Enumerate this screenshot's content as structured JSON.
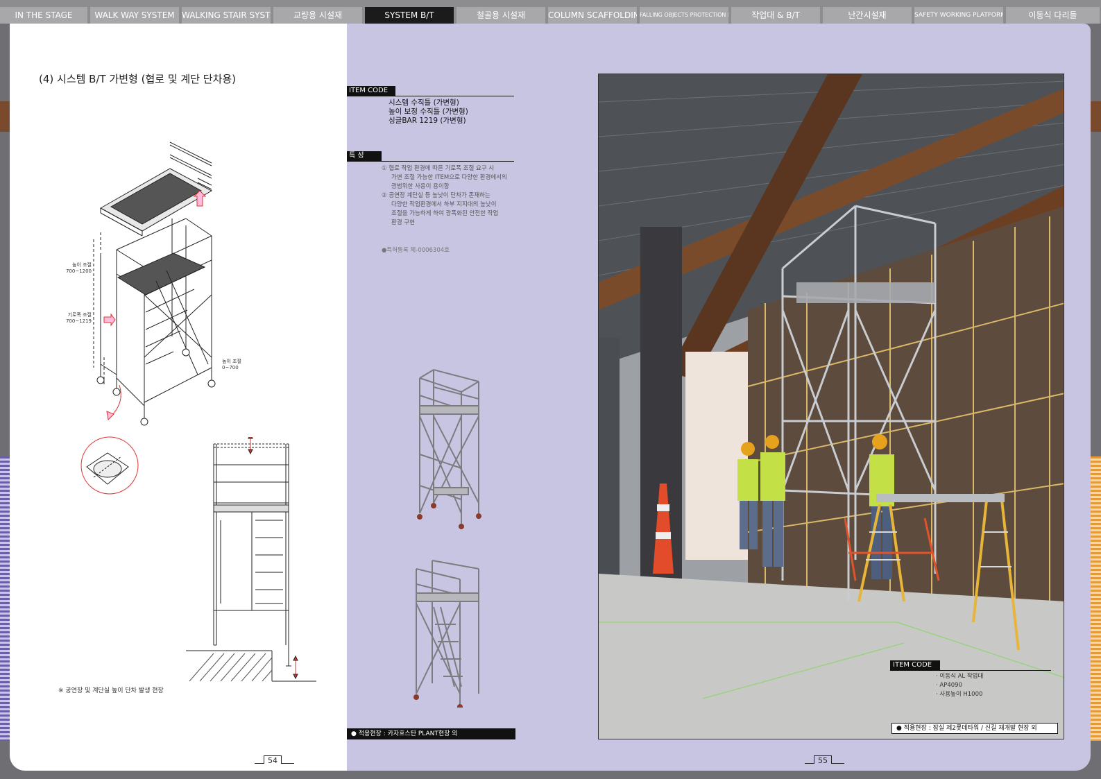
{
  "tabs": [
    {
      "label": "IN THE STAGE"
    },
    {
      "label": "WALK WAY SYSTEM"
    },
    {
      "label": "WALKING STAIR SYSTEM"
    },
    {
      "label": "교량용 시설재"
    },
    {
      "label": "SYSTEM B/T"
    },
    {
      "label": "철골용 시설재"
    },
    {
      "label": "COLUMN SCAFFOLDING"
    },
    {
      "label": "FALLING OBJECTS PROTECTION PLATFORM"
    },
    {
      "label": "작업대 & B/T"
    },
    {
      "label": "난간시설재"
    },
    {
      "label": "SAFETY WORKING PLATFORM"
    },
    {
      "label": "이동식 다리들"
    }
  ],
  "left_page": {
    "title": "(4) 시스템 B/T 가변형 (협로 및 계단 단차용)",
    "labels": {
      "height_adjust": "높이 조절",
      "height_range": "700~1200",
      "width_adjust": "기로폭 조절",
      "width_range": "700~1219",
      "leg_adjust": "높이 조절",
      "leg_range": "0~700"
    },
    "footnote": "※ 공연장 및 계단실 높이 단차 발생 현장",
    "page_number": "54"
  },
  "right_page": {
    "item_code_label": "ITEM CODE",
    "items": [
      "시스템 수직틀 (가변형)",
      "높이 보정 수직틀 (가변형)",
      "싱글BAR 1219 (가변형)"
    ],
    "features_label": "특 성",
    "features": [
      "① 협로 작업 환경에 따른 기로폭 조절 요구 시",
      "가변 조절 가능한 ITEM으로 다양한 환경에서의",
      "광범위한 사용이 용이함",
      "② 공연장 계단실 등 높낮이 단차가 존재하는",
      "다양한 작업환경에서 하부 지지대의 높낮이",
      "조절을 가능하게 하여 광폭화된 안전한 작업",
      "환경 구현"
    ],
    "patent": "●특허등록 제-0006304호",
    "site": "● 적용현장 : 카자흐스탄 PLANT현장 외",
    "photo": {
      "item_code_label": "ITEM CODE",
      "items": [
        "· 이동식 AL 작업대",
        "· AP4090",
        "· 사용높이 H1000"
      ],
      "site": "● 적용현장 : 잠실 제2롯데타워 / 신길 재개발 현장 외"
    },
    "page_number": "55"
  },
  "colors": {
    "right_page_bg": "#c8c5e2",
    "active_tab": "#1b1b1b",
    "tab": "#a8a8aa",
    "orange_stripe": "#e39a3a",
    "blue_stripe": "#6a5fa8"
  }
}
